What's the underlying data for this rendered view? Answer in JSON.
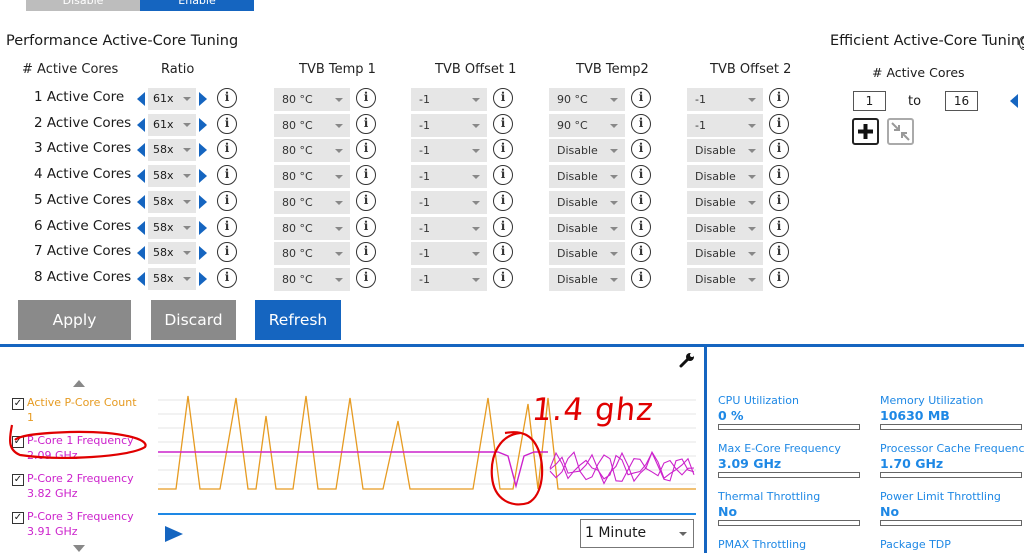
{
  "toggle": {
    "disable_label": "Disable",
    "enable_label": "Enable"
  },
  "performance": {
    "title": "Performance Active-Core Tuning",
    "headers": {
      "cores": "# Active Cores",
      "ratio": "Ratio",
      "tvb_temp1": "TVB Temp 1",
      "tvb_offset1": "TVB Offset 1",
      "tvb_temp2": "TVB Temp2",
      "tvb_offset2": "TVB Offset 2"
    },
    "rows": [
      {
        "label": "1 Active Core",
        "ratio": "61x",
        "temp1": "80 °C",
        "offset1": "-1",
        "temp2": "90 °C",
        "offset2": "-1"
      },
      {
        "label": "2 Active Cores",
        "ratio": "61x",
        "temp1": "80 °C",
        "offset1": "-1",
        "temp2": "90 °C",
        "offset2": "-1"
      },
      {
        "label": "3 Active Cores",
        "ratio": "58x",
        "temp1": "80 °C",
        "offset1": "-1",
        "temp2": "Disable",
        "offset2": "Disable"
      },
      {
        "label": "4 Active Cores",
        "ratio": "58x",
        "temp1": "80 °C",
        "offset1": "-1",
        "temp2": "Disable",
        "offset2": "Disable"
      },
      {
        "label": "5 Active Cores",
        "ratio": "58x",
        "temp1": "80 °C",
        "offset1": "-1",
        "temp2": "Disable",
        "offset2": "Disable"
      },
      {
        "label": "6 Active Cores",
        "ratio": "58x",
        "temp1": "80 °C",
        "offset1": "-1",
        "temp2": "Disable",
        "offset2": "Disable"
      },
      {
        "label": "7 Active Cores",
        "ratio": "58x",
        "temp1": "80 °C",
        "offset1": "-1",
        "temp2": "Disable",
        "offset2": "Disable"
      },
      {
        "label": "8 Active Cores",
        "ratio": "58x",
        "temp1": "80 °C",
        "offset1": "-1",
        "temp2": "Disable",
        "offset2": "Disable"
      }
    ],
    "buttons": {
      "apply": "Apply",
      "discard": "Discard",
      "refresh": "Refresh"
    }
  },
  "efficient": {
    "title": "Efficient Active-Core Tuning",
    "header": "# Active Cores",
    "range_from": "1",
    "range_to_label": "to",
    "range_to": "16"
  },
  "monitor": {
    "legend": [
      {
        "name": "Active P-Core Count",
        "value": "1",
        "color": "#e69b22",
        "checked": true
      },
      {
        "name": "P-Core 1 Frequency",
        "value": "2.09 GHz",
        "color": "#cc22cc",
        "checked": true
      },
      {
        "name": "P-Core 2 Frequency",
        "value": "3.82 GHz",
        "color": "#cc22cc",
        "checked": true
      },
      {
        "name": "P-Core 3 Frequency",
        "value": "3.91 GHz",
        "color": "#cc22cc",
        "checked": true
      }
    ],
    "annotation": "1.4 ghz",
    "time_range": "1 Minute",
    "icons": {
      "settings": "wrench-icon",
      "play": "play-icon"
    }
  },
  "metrics": [
    {
      "label": "CPU Utilization",
      "value": "0 %",
      "fill": 0.0
    },
    {
      "label": "Memory Utilization",
      "value": "10630  MB",
      "fill": 0.0
    },
    {
      "label": "Max E-Core Frequency",
      "value": "3.09 GHz",
      "fill": 0.0
    },
    {
      "label": "Processor Cache Frequency",
      "value": "1.70 GHz",
      "fill": 0.0
    },
    {
      "label": "Thermal Throttling",
      "value": "No",
      "fill": 0.0
    },
    {
      "label": "Power Limit Throttling",
      "value": "No",
      "fill": 0.0
    },
    {
      "label": "PMAX Throttling",
      "value": "",
      "fill": 0.0
    },
    {
      "label": "Package TDP",
      "value": "",
      "fill": 0.0
    }
  ],
  "colors": {
    "accent": "#1565c0",
    "metric": "#1e88e5",
    "orange": "#e69b22",
    "magenta": "#cc22cc",
    "annotation_red": "#e00000"
  }
}
